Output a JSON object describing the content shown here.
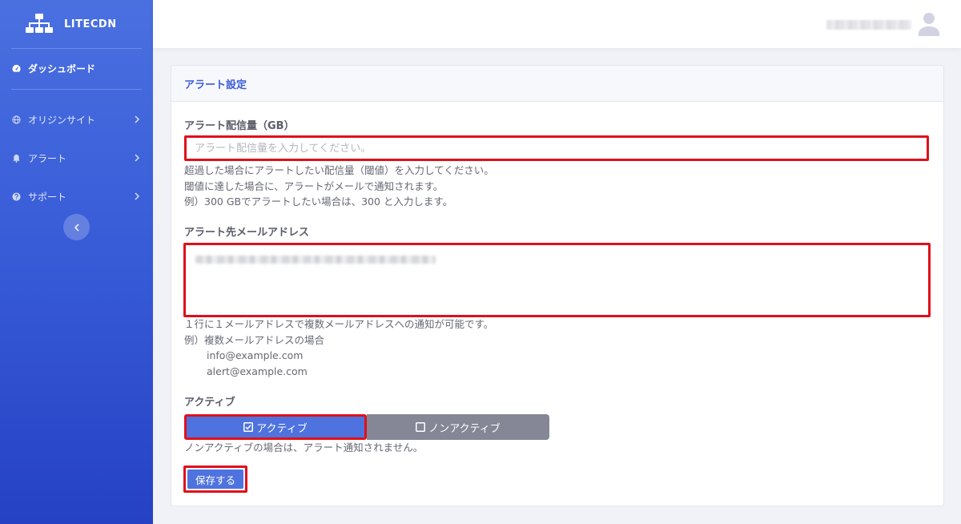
{
  "brand": {
    "name": "LITECDN"
  },
  "sidebar": {
    "items": [
      {
        "label": "ダッシュボード",
        "icon": "dashboard-icon"
      },
      {
        "label": "オリジンサイト",
        "icon": "globe-icon"
      },
      {
        "label": "アラート",
        "icon": "bell-icon"
      },
      {
        "label": "サポート",
        "icon": "question-icon"
      }
    ]
  },
  "card": {
    "title": "アラート設定"
  },
  "form": {
    "gb": {
      "label": "アラート配信量（GB）",
      "placeholder": "アラート配信量を入力してください。",
      "help": [
        "超過した場合にアラートしたい配信量（閾値）を入力してください。",
        "閾値に達した場合に、アラートがメールで通知されます。",
        "例）300 GBでアラートしたい場合は、300 と入力します。"
      ]
    },
    "email": {
      "label": "アラート先メールアドレス",
      "help": [
        "１行に１メールアドレスで複数メールアドレスへの通知が可能です。",
        "例）複数メールアドレスの場合",
        "info@example.com",
        "alert@example.com"
      ]
    },
    "active": {
      "label": "アクティブ",
      "on_label": "アクティブ",
      "off_label": "ノンアクティブ",
      "selected": "アクティブ",
      "help": "ノンアクティブの場合は、アラート通知されません。"
    },
    "save_label": "保存する"
  },
  "colors": {
    "primary": "#4e73df",
    "secondary": "#858796",
    "highlight": "#e0101a",
    "title": "#3b5bd9"
  }
}
